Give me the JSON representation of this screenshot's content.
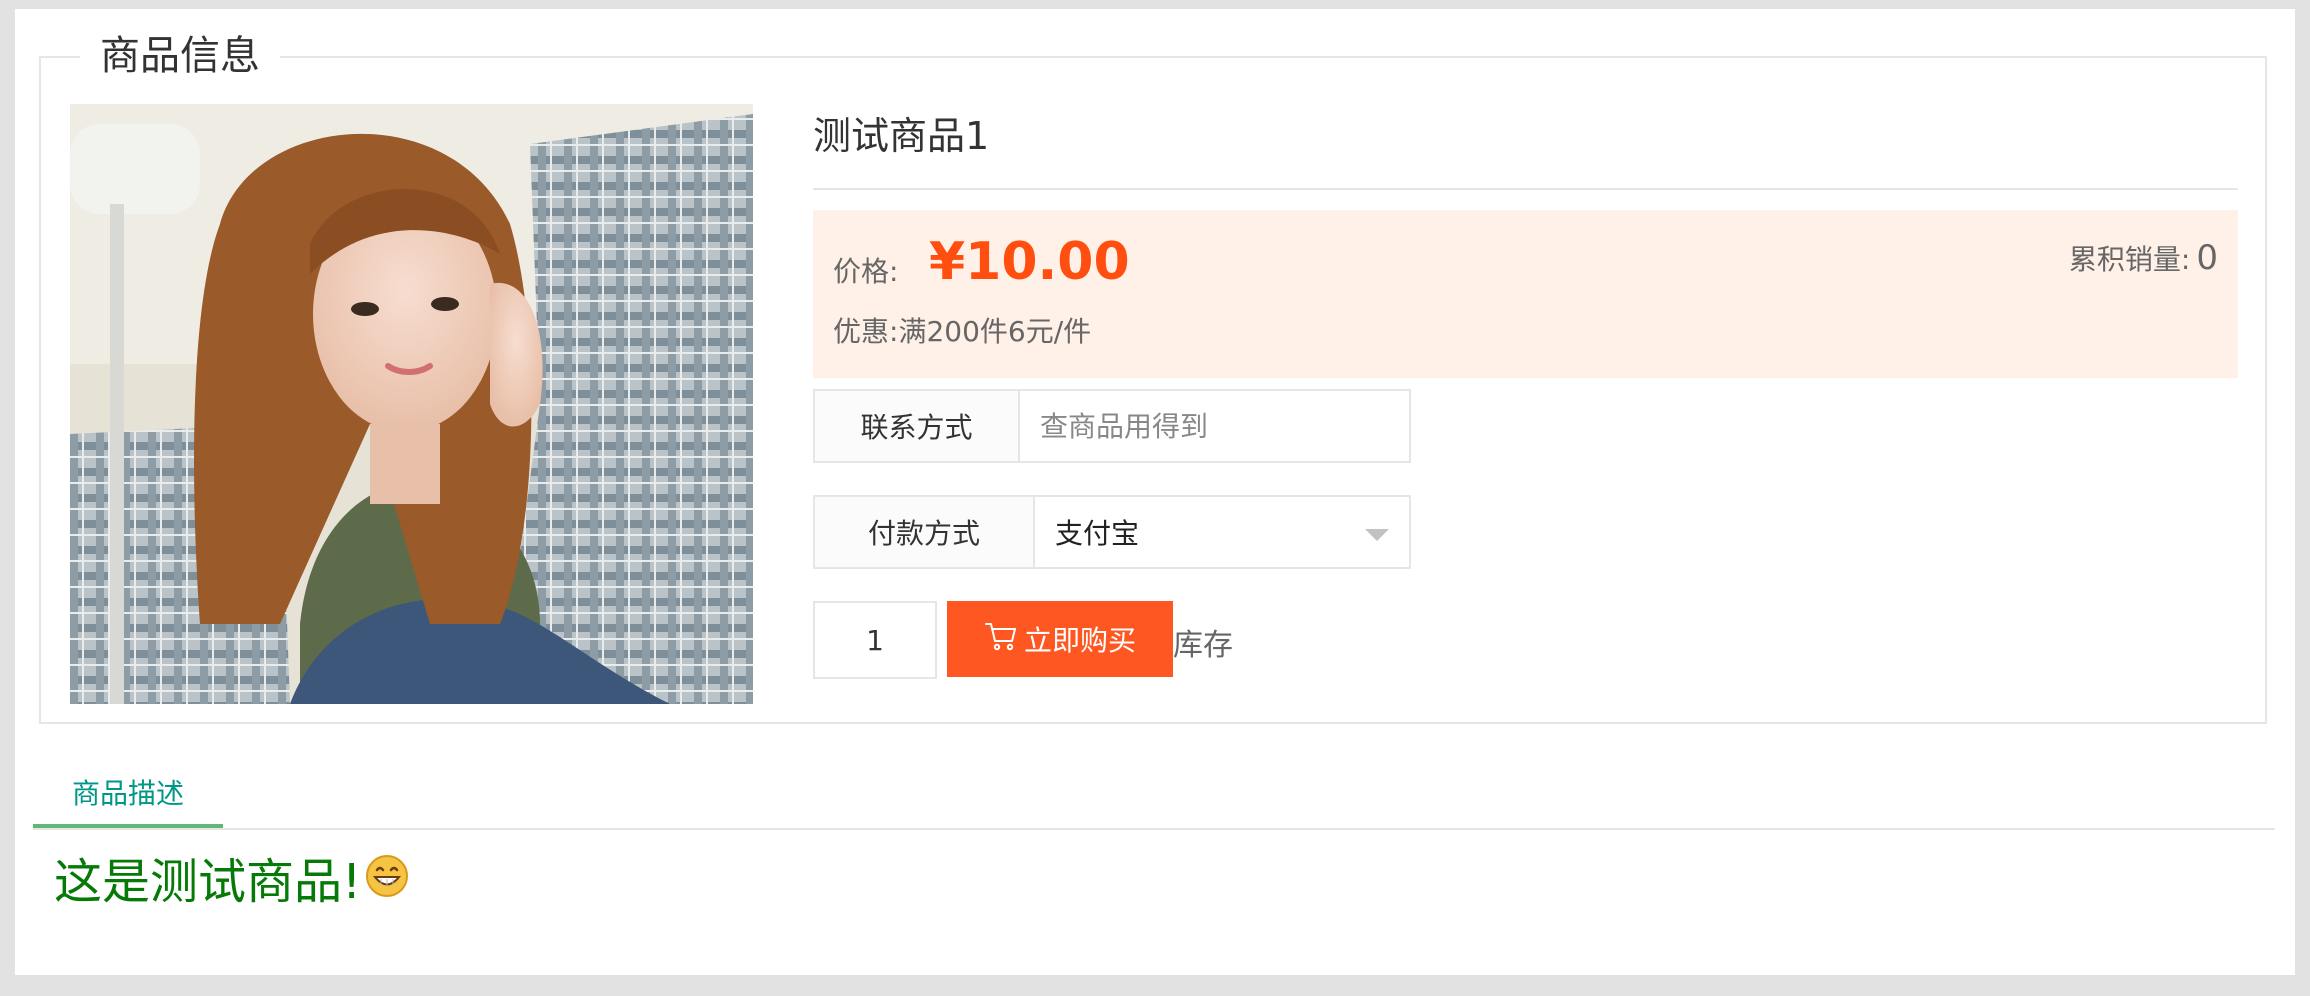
{
  "section": {
    "legend": "商品信息"
  },
  "product": {
    "title": "测试商品1",
    "price_label": "价格:",
    "price_value": "¥10.00",
    "discount_label": "优惠:",
    "discount_value": "满200件6元/件",
    "sales_label": "累积销量:",
    "sales_count": "0",
    "image_icon": "product-photo"
  },
  "form": {
    "contact_label": "联系方式",
    "contact_placeholder": "查商品用得到",
    "contact_value": "",
    "payment_label": "付款方式",
    "payment_selected": "支付宝",
    "quantity": "1",
    "buy_label": "立即购买",
    "buy_icon": "cart-icon",
    "stock_label": "库存"
  },
  "tabs": [
    {
      "label": "商品描述",
      "active": true
    }
  ],
  "description": {
    "text": "这是测试商品!",
    "emoji": "grinning-face-icon"
  },
  "colors": {
    "accent": "#ff5722",
    "price": "#ff4e0f",
    "price_bg": "#fff1e8",
    "tab_active": "#009688",
    "tab_underline": "#5fb878",
    "description_text": "#067a06"
  }
}
